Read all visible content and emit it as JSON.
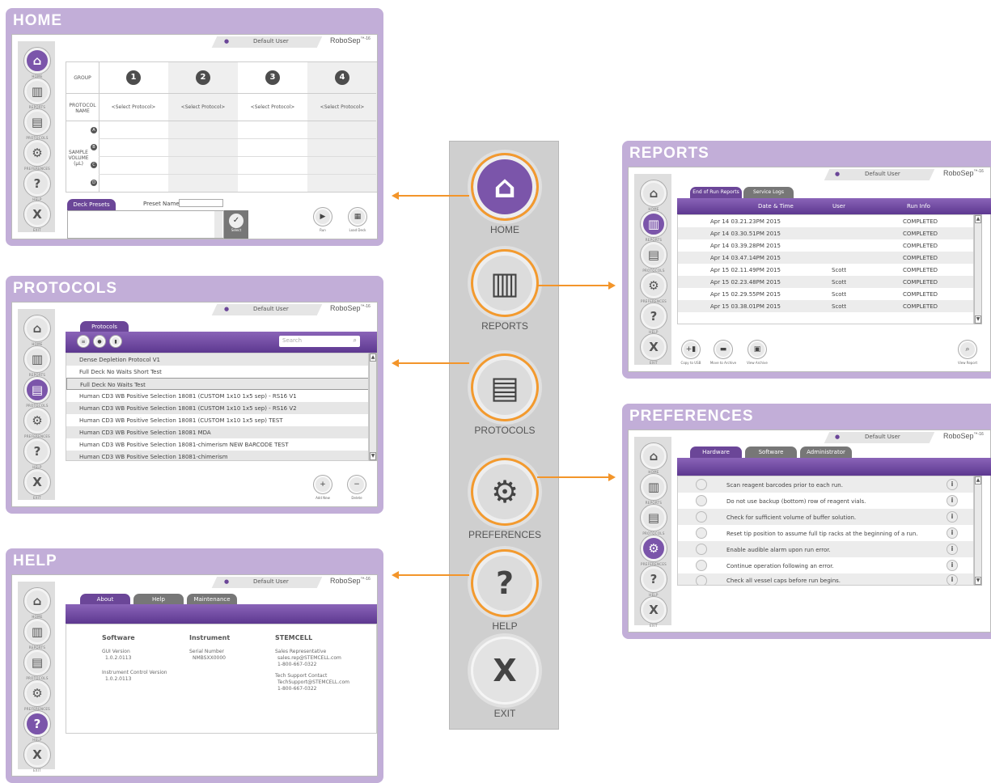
{
  "sidebar_labels": [
    "HOME",
    "REPORTS",
    "PROTOCOLS",
    "PREFERENCES",
    "HELP",
    "EXIT"
  ],
  "user": "Default User",
  "brand": "RoboSep",
  "brand_sup": "™-16",
  "home": {
    "title": "HOME",
    "groups": [
      "1",
      "2",
      "3",
      "4"
    ],
    "labels": {
      "group": "GROUP",
      "protocol": "PROTOCOL NAME",
      "sample": "SAMPLE VOLUME (µL)"
    },
    "rows": [
      "A",
      "B",
      "C",
      "D"
    ],
    "select_protocol": "<Select Protocol>",
    "deck_presets": "Deck Presets",
    "preset_name": "Preset Name:",
    "select": "Select",
    "run": "Run",
    "load_deck": "Load Deck"
  },
  "protocols": {
    "title": "PROTOCOLS",
    "tab": "Protocols",
    "search": "Search",
    "items": [
      "Dense Depletion Protocol V1",
      "Full Deck No Waits Short Test",
      "Full Deck No Waits Test",
      "Human CD3 WB Positive Selection 18081 (CUSTOM 1x10 1x5 sep) - RS16 V1",
      "Human CD3 WB Positive Selection 18081 (CUSTOM 1x10 1x5 sep) - RS16 V2",
      "Human CD3 WB Positive Selection 18081 (CUSTOM 1x10 1x5 sep) TEST",
      "Human CD3 WB Positive Selection 18081 MDA",
      "Human CD3 WB Positive Selection 18081-chimerism NEW BARCODE TEST",
      "Human CD3 WB Positive Selection 18081-chimerism"
    ],
    "add_new": "Add New",
    "delete": "Delete"
  },
  "help": {
    "title": "HELP",
    "tabs": [
      "About",
      "Help",
      "Maintenance"
    ],
    "software": {
      "heading": "Software",
      "gui_label": "GUI Version",
      "gui_value": "1.0.2.0113",
      "ctrl_label": "Instrument Control Version",
      "ctrl_value": "1.0.2.0113"
    },
    "instrument": {
      "heading": "Instrument",
      "serial_label": "Serial Number",
      "serial_value": "NMBSXX0000"
    },
    "stemcell": {
      "heading": "STEMCELL",
      "sales_label": "Sales Representative",
      "sales_email": "sales.rep@STEMCELL.com",
      "sales_phone": "1-800-667-0322",
      "tech_label": "Tech Support Contact",
      "tech_email": "TechSupport@STEMCELL.com",
      "tech_phone": "1-800-667-0322"
    }
  },
  "reports": {
    "title": "REPORTS",
    "tabs": [
      "End of Run Reports",
      "Service Logs"
    ],
    "columns": [
      "Date & Time",
      "User",
      "Run Info"
    ],
    "rows": [
      {
        "date": "Apr 14 03.21.23PM 2015",
        "user": "",
        "info": "COMPLETED"
      },
      {
        "date": "Apr 14 03.30.51PM 2015",
        "user": "",
        "info": "COMPLETED"
      },
      {
        "date": "Apr 14 03.39.28PM 2015",
        "user": "",
        "info": "COMPLETED"
      },
      {
        "date": "Apr 14 03.47.14PM 2015",
        "user": "",
        "info": "COMPLETED"
      },
      {
        "date": "Apr 15 02.11.49PM 2015",
        "user": "Scott",
        "info": "COMPLETED"
      },
      {
        "date": "Apr 15 02.23.48PM 2015",
        "user": "Scott",
        "info": "COMPLETED"
      },
      {
        "date": "Apr 15 02.29.55PM 2015",
        "user": "Scott",
        "info": "COMPLETED"
      },
      {
        "date": "Apr 15 03.38.01PM 2015",
        "user": "Scott",
        "info": "COMPLETED"
      }
    ],
    "copy": "Copy to USB",
    "move": "Move to Archive",
    "view_archive": "View Archive",
    "view_report": "View Report"
  },
  "preferences": {
    "title": "PREFERENCES",
    "tabs": [
      "Hardware",
      "Software",
      "Administrator"
    ],
    "items": [
      "Scan reagent barcodes prior to each run.",
      "Do not use backup (bottom) row of reagent vials.",
      "Check for sufficient volume of buffer solution.",
      "Reset tip position to assume full tip racks at the beginning of a run.",
      "Enable audible alarm upon run error.",
      "Continue operation following an error.",
      "Check all vessel caps before run begins."
    ]
  },
  "menu": [
    "HOME",
    "REPORTS",
    "PROTOCOLS",
    "PREFERENCES",
    "HELP",
    "EXIT"
  ],
  "colors": {
    "accent": "#6b4698",
    "frame": "#c2aed8",
    "arrow": "#f3952a"
  }
}
